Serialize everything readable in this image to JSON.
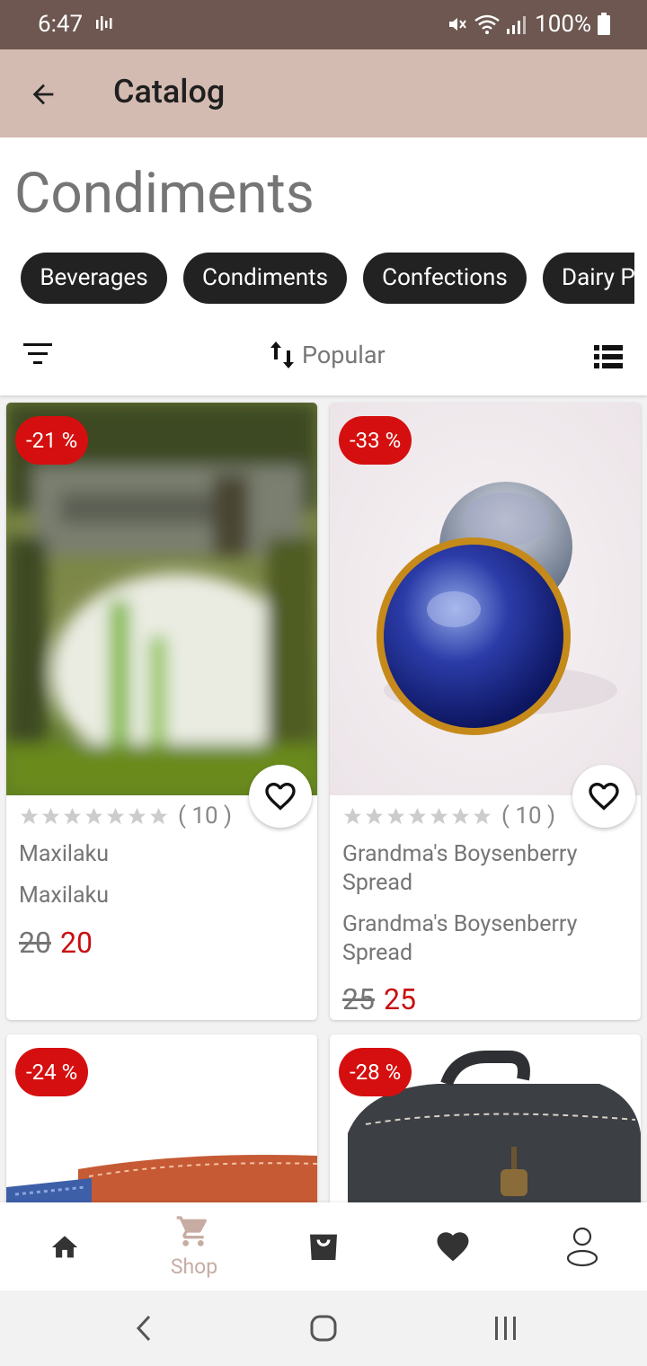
{
  "status": {
    "time": "6:47",
    "battery": "100%"
  },
  "appbar": {
    "title": "Catalog"
  },
  "page": {
    "title": "Condiments"
  },
  "categories": [
    "Beverages",
    "Condiments",
    "Confections",
    "Dairy P"
  ],
  "toolbar": {
    "sort_label": "Popular"
  },
  "products": [
    {
      "discount": "-21 %",
      "rating_count": "( 10 )",
      "name": "Maxilaku",
      "subtitle": "Maxilaku",
      "old_price": "20",
      "new_price": "20"
    },
    {
      "discount": "-33 %",
      "rating_count": "( 10 )",
      "name": "Grandma's Boysenberry Spread",
      "subtitle": "Grandma's Boysenberry Spread",
      "old_price": "25",
      "new_price": "25"
    },
    {
      "discount": "-24 %"
    },
    {
      "discount": "-28 %"
    }
  ],
  "nav": {
    "shop_label": "Shop"
  },
  "colors": {
    "status_bar": "#6d5750",
    "app_bar": "#d4bbb2",
    "accent_red": "#d50f0f",
    "chip": "#222222",
    "nav_active": "#c7aca3"
  }
}
